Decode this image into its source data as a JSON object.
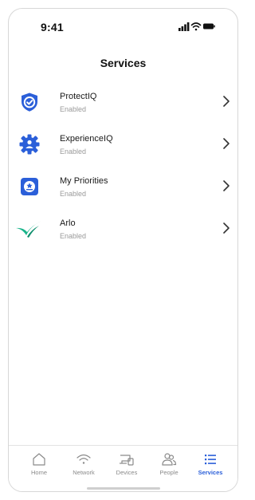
{
  "status_bar": {
    "time": "9:41",
    "icons": [
      "signal-icon",
      "wifi-icon",
      "battery-icon"
    ]
  },
  "header": {
    "title": "Services"
  },
  "services": [
    {
      "name": "ProtectIQ",
      "status": "Enabled",
      "icon": "shield-check-icon",
      "color": "#2b5fd9"
    },
    {
      "name": "ExperienceIQ",
      "status": "Enabled",
      "icon": "gear-person-icon",
      "color": "#2b5fd9"
    },
    {
      "name": "My Priorities",
      "status": "Enabled",
      "icon": "priority-badge-icon",
      "color": "#2b5fd9"
    },
    {
      "name": "Arlo",
      "status": "Enabled",
      "icon": "arlo-bird-icon",
      "color": "#18b48a"
    }
  ],
  "tab_bar": {
    "tabs": [
      {
        "label": "Home",
        "icon": "house-icon",
        "active": false
      },
      {
        "label": "Network",
        "icon": "wifi-icon",
        "active": false
      },
      {
        "label": "Devices",
        "icon": "devices-icon",
        "active": false
      },
      {
        "label": "People",
        "icon": "people-icon",
        "active": false
      },
      {
        "label": "Services",
        "icon": "list-icon",
        "active": true
      }
    ]
  },
  "colors": {
    "accent": "#2b5fd9",
    "arlo": "#18b48a",
    "inactive": "#8a8a8a"
  }
}
